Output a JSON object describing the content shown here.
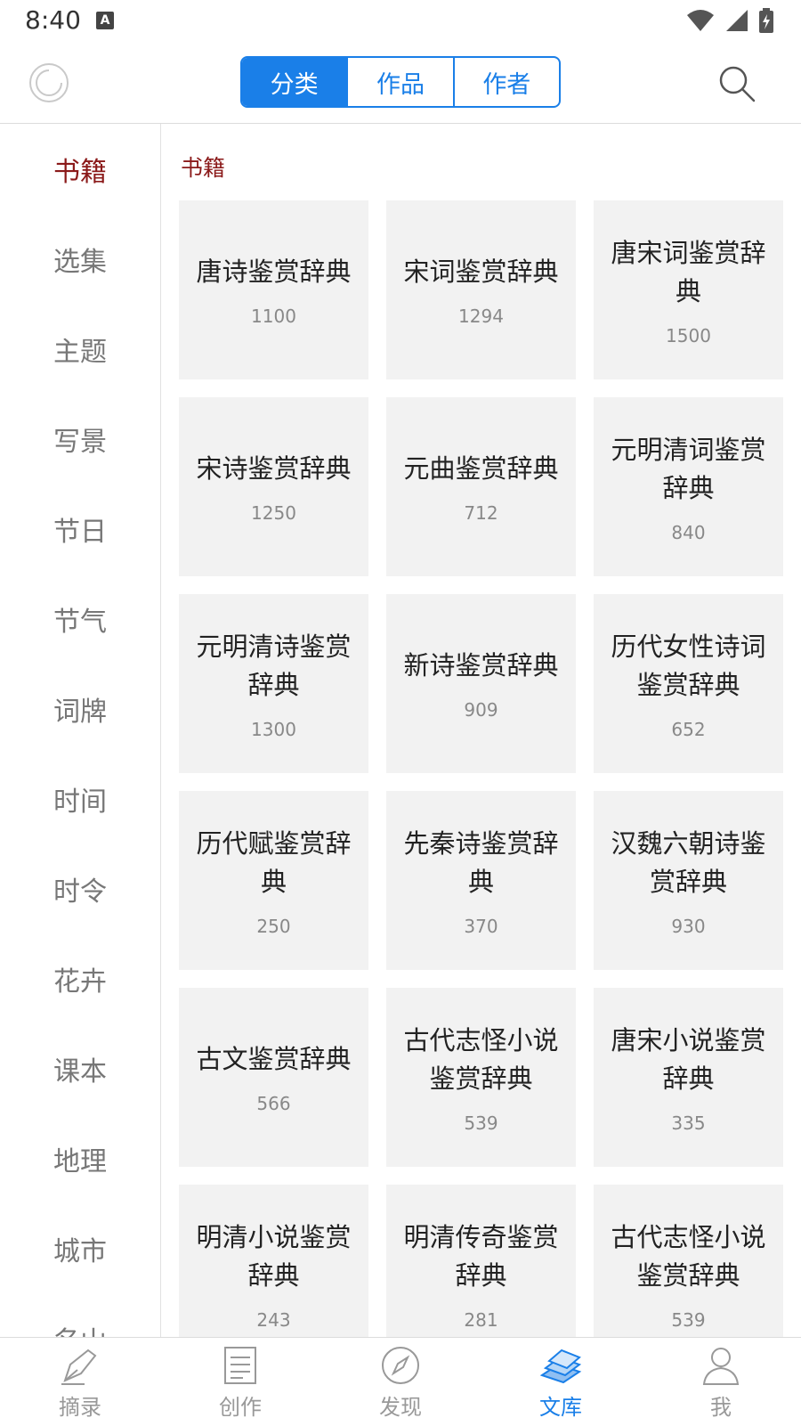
{
  "status": {
    "time": "8:40",
    "notif": "A"
  },
  "header": {
    "tabs": [
      {
        "label": "分类",
        "active": true
      },
      {
        "label": "作品",
        "active": false
      },
      {
        "label": "作者",
        "active": false
      }
    ]
  },
  "sidebar": {
    "items": [
      "书籍",
      "选集",
      "主题",
      "写景",
      "节日",
      "节气",
      "词牌",
      "时间",
      "时令",
      "花卉",
      "课本",
      "地理",
      "城市",
      "名山"
    ],
    "active": "书籍"
  },
  "section": {
    "title": "书籍"
  },
  "books": [
    {
      "title": "唐诗鉴赏辞典",
      "count": "1100"
    },
    {
      "title": "宋词鉴赏辞典",
      "count": "1294"
    },
    {
      "title": "唐宋词鉴赏辞典",
      "count": "1500"
    },
    {
      "title": "宋诗鉴赏辞典",
      "count": "1250"
    },
    {
      "title": "元曲鉴赏辞典",
      "count": "712"
    },
    {
      "title": "元明清词鉴赏辞典",
      "count": "840"
    },
    {
      "title": "元明清诗鉴赏辞典",
      "count": "1300"
    },
    {
      "title": "新诗鉴赏辞典",
      "count": "909"
    },
    {
      "title": "历代女性诗词鉴赏辞典",
      "count": "652"
    },
    {
      "title": "历代赋鉴赏辞典",
      "count": "250"
    },
    {
      "title": "先秦诗鉴赏辞典",
      "count": "370"
    },
    {
      "title": "汉魏六朝诗鉴赏辞典",
      "count": "930"
    },
    {
      "title": "古文鉴赏辞典",
      "count": "566"
    },
    {
      "title": "古代志怪小说鉴赏辞典",
      "count": "539"
    },
    {
      "title": "唐宋小说鉴赏辞典",
      "count": "335"
    },
    {
      "title": "明清小说鉴赏辞典",
      "count": "243"
    },
    {
      "title": "明清传奇鉴赏辞典",
      "count": "281"
    },
    {
      "title": "古代志怪小说鉴赏辞典",
      "count": "539"
    }
  ],
  "bottom_nav": [
    {
      "label": "摘录",
      "icon": "pen-nib-icon",
      "active": false
    },
    {
      "label": "创作",
      "icon": "document-lines-icon",
      "active": false
    },
    {
      "label": "发现",
      "icon": "compass-icon",
      "active": false
    },
    {
      "label": "文库",
      "icon": "books-icon",
      "active": true
    },
    {
      "label": "我",
      "icon": "person-icon",
      "active": false
    }
  ],
  "colors": {
    "accent": "#1a7fe8",
    "active_category": "#8b1a1a",
    "card_bg": "#f2f2f2"
  }
}
